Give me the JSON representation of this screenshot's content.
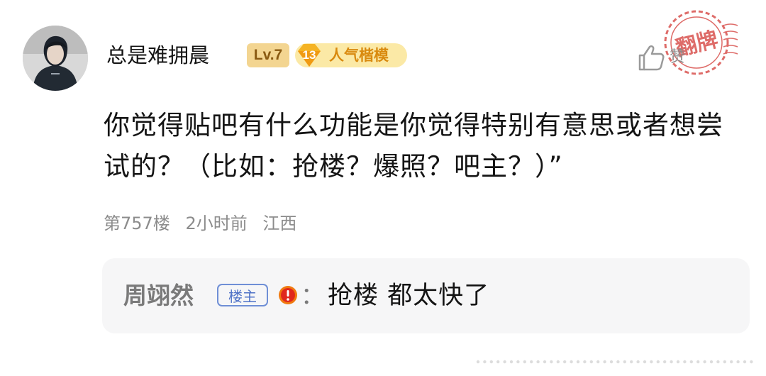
{
  "post": {
    "username": "总是难拥晨",
    "level_badge": "Lv.7",
    "popularity_level": "13",
    "popularity_title": "人气楷模",
    "like_label": "赞",
    "content": "你觉得贴吧有什么功能是你觉得特别有意思或者想尝试的？（比如：抢楼？爆照？吧主？）”",
    "floor": "第757楼",
    "time": "2小时前",
    "location": "江西"
  },
  "reply": {
    "author": "周翊然",
    "author_badge": "楼主",
    "colon": "：",
    "text": "抢楼 都太快了"
  },
  "stamp": {
    "text": "翻牌"
  },
  "colors": {
    "level_badge_bg": "#f3d591",
    "popularity_bg": "#fbe9a6",
    "popularity_text": "#d98a0f",
    "owner_badge": "#4f72c7",
    "stamp_red": "#d9534f",
    "reply_box_bg": "#f6f6f7"
  },
  "icons": {
    "like": "thumbs-up-icon",
    "warning": "warning-circle-icon"
  }
}
